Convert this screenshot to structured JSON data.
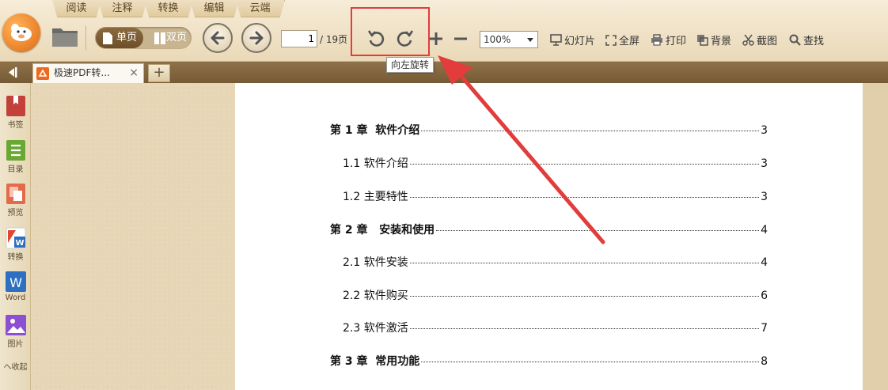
{
  "menu_tabs": [
    "阅读",
    "注释",
    "转换",
    "编辑",
    "云端"
  ],
  "view_toggle": {
    "single": "单页",
    "double": "双页"
  },
  "page_nav": {
    "current": "1",
    "total": "/ 19页"
  },
  "zoom": {
    "value": "100%"
  },
  "tools": [
    {
      "icon": "slideshow-icon",
      "label": "幻灯片"
    },
    {
      "icon": "fullscreen-icon",
      "label": "全屏"
    },
    {
      "icon": "print-icon",
      "label": "打印"
    },
    {
      "icon": "background-icon",
      "label": "背景"
    },
    {
      "icon": "screenshot-icon",
      "label": "截图"
    },
    {
      "icon": "search-icon",
      "label": "查找"
    }
  ],
  "tooltip": "向左旋转",
  "doc_tab": {
    "title": "极速PDF转...",
    "close": "×",
    "add": "+"
  },
  "sidebar": [
    {
      "label": "书签",
      "color": "#c2413a"
    },
    {
      "label": "目录",
      "color": "#6aa834"
    },
    {
      "label": "预览",
      "color": "#e36a4a"
    },
    {
      "label": "转换",
      "color": "#e3462d"
    },
    {
      "label": "Word",
      "color": "#2d6fc1"
    },
    {
      "label": "图片",
      "color": "#8c4fd4"
    }
  ],
  "sidebar_collapse": "へ收起",
  "toc": [
    {
      "label": "第 1 章  软件介绍",
      "page": "3",
      "level": "chapter"
    },
    {
      "label": "1.1 软件介绍",
      "page": "3",
      "level": "sub"
    },
    {
      "label": "1.2 主要特性",
      "page": "3",
      "level": "sub"
    },
    {
      "label": "第 2 章   安装和使用",
      "page": "4",
      "level": "chapter"
    },
    {
      "label": "2.1 软件安装",
      "page": "4",
      "level": "sub"
    },
    {
      "label": "2.2 软件购买",
      "page": "6",
      "level": "sub"
    },
    {
      "label": "2.3 软件激活",
      "page": "7",
      "level": "sub"
    },
    {
      "label": "第 3 章  常用功能",
      "page": "8",
      "level": "chapter"
    }
  ],
  "colors": {
    "highlight": "#e23c3c",
    "accent": "#765a35"
  }
}
